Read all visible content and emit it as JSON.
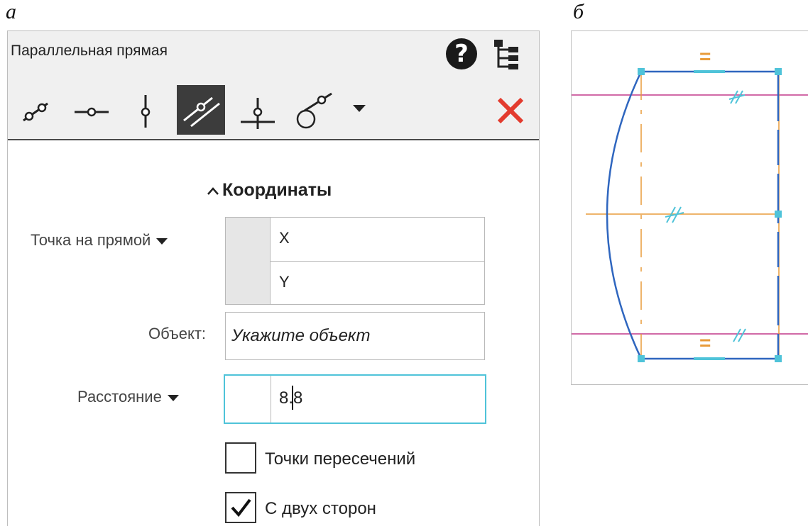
{
  "figure_labels": {
    "left": "а",
    "right": "б"
  },
  "panel": {
    "title": "Параллельная прямая",
    "help_icon": "help-icon",
    "tree_icon": "tree-icon",
    "tools": [
      "line-by-two-points-icon",
      "line-horizontal-icon",
      "line-vertical-icon",
      "parallel-line-icon",
      "perpendicular-line-icon",
      "tangent-line-icon"
    ],
    "active_tool": "parallel-line-icon",
    "close_icon": "close-icon",
    "section_title": "Координаты",
    "point_label": "Точка на прямой",
    "x_label": "X",
    "y_label": "Y",
    "x_value": "",
    "y_value": "",
    "object_label": "Объект:",
    "object_placeholder": "Укажите объект",
    "distance_label": "Расстояние",
    "distance_value": "8.8",
    "intersections_label": "Точки пересечений",
    "intersections_checked": false,
    "both_sides_label": "С двух сторон",
    "both_sides_checked": true
  },
  "sketch": {
    "equal_mark": "=",
    "colors": {
      "contour": "#2f66bf",
      "axis": "#e89b3a",
      "parallel": "#c2388a",
      "point": "#4fc3d9"
    }
  }
}
